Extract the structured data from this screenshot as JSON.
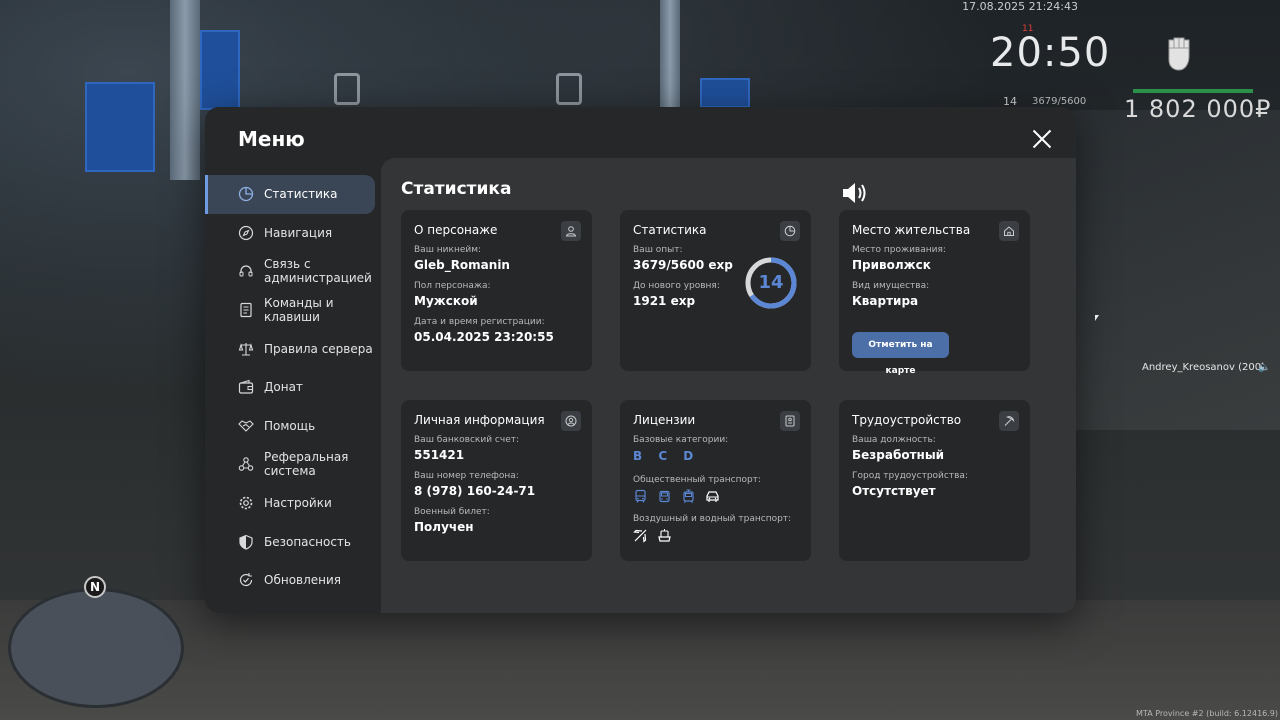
{
  "hud": {
    "datetime": "17.08.2025 21:24:43",
    "clock": "20:50",
    "level": "14",
    "exp": "3679/5600",
    "money": "1 802 000₽",
    "player_tag": "Andrey_Kreosanov (200)",
    "build": "MTA Province #2 (build: 6.12416.9)",
    "minimap_north": "N"
  },
  "menu": {
    "title": "Меню",
    "sidebar": [
      {
        "label": "Статистика",
        "icon": "pie-chart-icon"
      },
      {
        "label": "Навигация",
        "icon": "compass-icon"
      },
      {
        "label": "Связь с администрацией",
        "icon": "headset-icon"
      },
      {
        "label": "Команды и клавиши",
        "icon": "document-icon"
      },
      {
        "label": "Правила сервера",
        "icon": "scales-icon"
      },
      {
        "label": "Донат",
        "icon": "wallet-icon"
      },
      {
        "label": "Помощь",
        "icon": "handshake-icon"
      },
      {
        "label": "Реферальная система",
        "icon": "network-icon"
      },
      {
        "label": "Настройки",
        "icon": "gear-icon"
      },
      {
        "label": "Безопасность",
        "icon": "shield-icon"
      },
      {
        "label": "Обновления",
        "icon": "update-icon"
      }
    ],
    "content_title": "Статистика",
    "cards": {
      "character": {
        "title": "О персонаже",
        "nick_label": "Ваш никнейм:",
        "nick": "Gleb_Romanin",
        "sex_label": "Пол персонажа:",
        "sex": "Мужской",
        "reg_label": "Дата и время регистрации:",
        "reg": "05.04.2025 23:20:55"
      },
      "stats": {
        "title": "Статистика",
        "exp_label": "Ваш опыт:",
        "exp": "3679/5600 exp",
        "next_label": "До нового уровня:",
        "next": "1921 exp",
        "level": "14",
        "progress": 0.657
      },
      "residence": {
        "title": "Место жительства",
        "place_label": "Место проживания:",
        "place": "Приволжск",
        "type_label": "Вид имущества:",
        "type": "Квартира",
        "map_button": "Отметить на карте"
      },
      "personal": {
        "title": "Личная информация",
        "bank_label": "Ваш банковский счет:",
        "bank": "551421",
        "phone_label": "Ваш номер телефона:",
        "phone": "8 (978) 160-24-71",
        "military_label": "Военный билет:",
        "military": "Получен"
      },
      "licenses": {
        "title": "Лицензии",
        "base_label": "Базовые категории:",
        "base": "B C D",
        "public_label": "Общественный транспорт:",
        "air_label": "Воздушный и водный транспорт:"
      },
      "job": {
        "title": "Трудоустройство",
        "position_label": "Ваша должность:",
        "position": "Безработный",
        "city_label": "Город трудоустройства:",
        "city": "Отсутствует"
      }
    }
  },
  "colors": {
    "accent": "#5b87d4",
    "button": "#4c6fa8",
    "panel": "#252729",
    "content": "#333537"
  }
}
